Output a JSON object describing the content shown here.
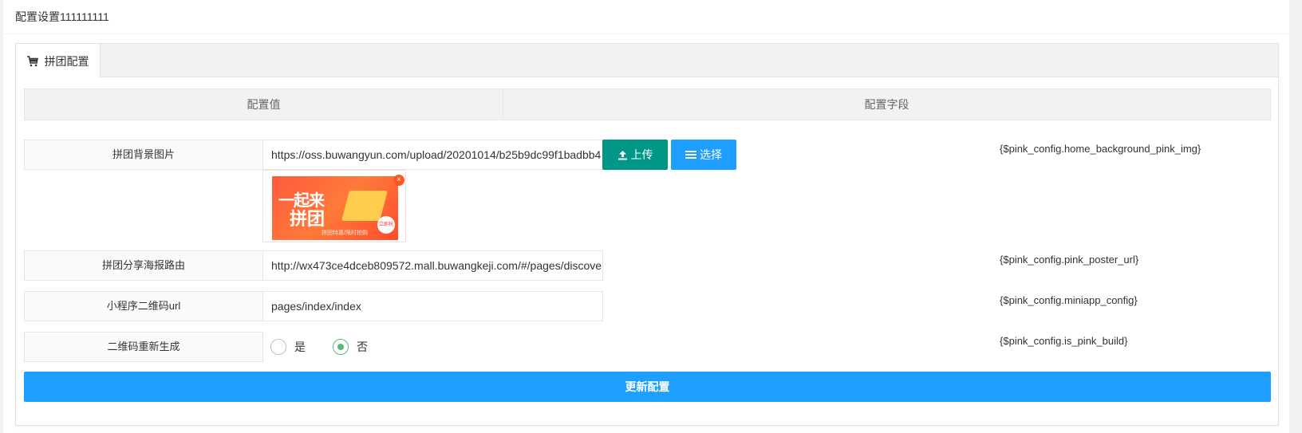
{
  "panel": {
    "title": "配置设置111111111"
  },
  "tabs": [
    {
      "label": "拼团配置",
      "icon": "cart-icon",
      "active": true
    }
  ],
  "table": {
    "headers": [
      "配置值",
      "配置字段"
    ]
  },
  "rows": [
    {
      "label": "拼团背景图片",
      "value": "https://oss.buwangyun.com/upload/20201014/b25b9dc99f1badbb4",
      "field": "{$pink_config.home_background_pink_img}",
      "upload_label": "上传",
      "select_label": "选择",
      "thumb": {
        "line1": "一起来",
        "line2": "拼团",
        "caption": "拼团特惠/限时抢购",
        "badge": "立即抢"
      }
    },
    {
      "label": "拼团分享海报路由",
      "value": "http://wx473ce4dceb809572.mall.buwangkeji.com/#/pages/discove",
      "field": "{$pink_config.pink_poster_url}"
    },
    {
      "label": "小程序二维码url",
      "value": "pages/index/index",
      "field": "{$pink_config.miniapp_config}"
    },
    {
      "label": "二维码重新生成",
      "options": [
        "是",
        "否"
      ],
      "selected": "否",
      "field": "{$pink_config.is_pink_build}"
    }
  ],
  "submit_label": "更新配置",
  "colors": {
    "upload": "#009688",
    "primary": "#1e9fff",
    "radio_checked": "#5fb878"
  }
}
